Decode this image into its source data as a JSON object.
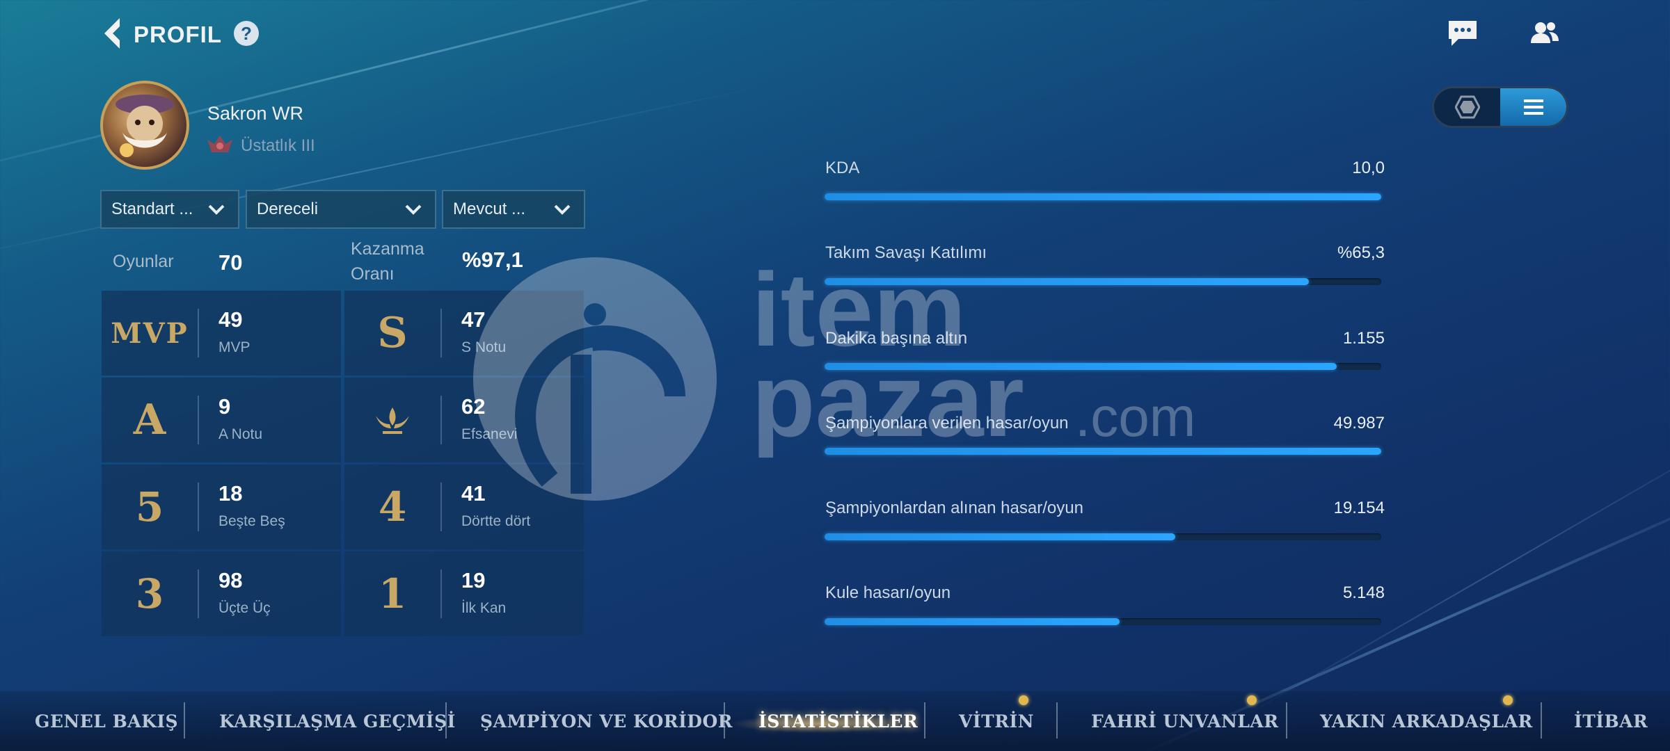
{
  "header": {
    "title": "PROFIL",
    "help": "?"
  },
  "player": {
    "name": "Sakron WR",
    "rank": "Üstatlık III"
  },
  "filters": [
    {
      "label": "Standart ..."
    },
    {
      "label": "Dereceli"
    },
    {
      "label": "Mevcut ..."
    }
  ],
  "summary": {
    "games_label": "Oyunlar",
    "games_value": "70",
    "winrate_label": "Kazanma Oranı",
    "winrate_value": "%97,1"
  },
  "achievements": [
    {
      "badge": "MVP",
      "value": "49",
      "label": "MVP"
    },
    {
      "badge": "S",
      "value": "47",
      "label": "S Notu"
    },
    {
      "badge": "A",
      "value": "9",
      "label": "A Notu"
    },
    {
      "badge": "legendary",
      "value": "62",
      "label": "Efsanevi"
    },
    {
      "badge": "5",
      "value": "18",
      "label": "Beşte Beş"
    },
    {
      "badge": "4",
      "value": "41",
      "label": "Dörtte dört"
    },
    {
      "badge": "3",
      "value": "98",
      "label": "Üçte Üç"
    },
    {
      "badge": "1",
      "value": "19",
      "label": "İlk Kan"
    }
  ],
  "stats": [
    {
      "label": "KDA",
      "value": "10,0",
      "fill": 1.0
    },
    {
      "label": "Takım Savaşı Katılımı",
      "value": "%65,3",
      "fill": 0.87
    },
    {
      "label": "Dakika başına altın",
      "value": "1.155",
      "fill": 0.92
    },
    {
      "label": "Şampiyonlara verilen hasar/oyun",
      "value": "49.987",
      "fill": 1.0
    },
    {
      "label": "Şampiyonlardan alınan hasar/oyun",
      "value": "19.154",
      "fill": 0.63
    },
    {
      "label": "Kule hasarı/oyun",
      "value": "5.148",
      "fill": 0.53
    }
  ],
  "watermark": {
    "line1": "item",
    "line2": "pazar",
    "suffix": ".com"
  },
  "nav": [
    {
      "label": "GENEL BAKIŞ",
      "active": false,
      "dot": false
    },
    {
      "label": "KARŞILAŞMA GEÇMİŞİ",
      "active": false,
      "dot": false
    },
    {
      "label": "ŞAMPİYON VE KORİDOR",
      "active": false,
      "dot": false
    },
    {
      "label": "İSTATİSTİKLER",
      "active": true,
      "dot": false
    },
    {
      "label": "VİTRİN",
      "active": false,
      "dot": true
    },
    {
      "label": "FAHRİ UNVANLAR",
      "active": false,
      "dot": true
    },
    {
      "label": "YAKIN ARKADAŞLAR",
      "active": false,
      "dot": true
    },
    {
      "label": "İTİBAR",
      "active": false,
      "dot": false
    }
  ],
  "colors": {
    "accent": "#2aa6ff",
    "gold": "#c9a765",
    "notification": "#e1b74f"
  }
}
